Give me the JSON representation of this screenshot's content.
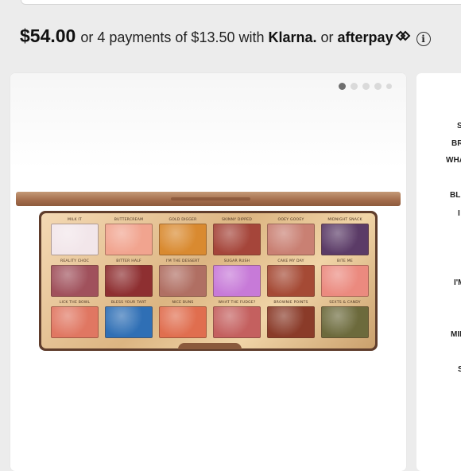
{
  "pricing": {
    "price": "$54.00",
    "installments_text": "or 4 payments of $13.50 with",
    "klarna_label": "Klarna.",
    "or_text": "or",
    "afterpay_label": "afterpay"
  },
  "icons": {
    "afterpay": "afterpay-arrows-icon",
    "info": "info-icon"
  },
  "gallery": {
    "dots": [
      true,
      false,
      false,
      false,
      false
    ]
  },
  "side_panel_fragments": [
    "S",
    "BR",
    "WHA",
    "BLE",
    "I",
    "I'M",
    "MIL",
    "S"
  ],
  "palette": {
    "shades": [
      {
        "name": "MILK IT",
        "color": "#f2e6ea"
      },
      {
        "name": "BUTTERCREAM",
        "color": "#f1a48f"
      },
      {
        "name": "GOLD DIGGER",
        "color": "#d98a30"
      },
      {
        "name": "SKINNY DIPPED",
        "color": "#a5453a"
      },
      {
        "name": "OOEY GOOEY",
        "color": "#c98073"
      },
      {
        "name": "MIDNIGHT SNACK",
        "color": "#5b3b67"
      },
      {
        "name": "REALITY CHOC",
        "color": "#a0515c"
      },
      {
        "name": "BITTER HALF",
        "color": "#8e2f31"
      },
      {
        "name": "I'M THE DESSERT",
        "color": "#b06f63"
      },
      {
        "name": "SUGAR RUSH",
        "color": "#c77ad8"
      },
      {
        "name": "CAKE MY DAY",
        "color": "#a54a35"
      },
      {
        "name": "BITE ME",
        "color": "#eb8a7f"
      },
      {
        "name": "LICK THE BOWL",
        "color": "#e07762"
      },
      {
        "name": "BLESS YOUR TART",
        "color": "#2f6fb5"
      },
      {
        "name": "NICE BUNS",
        "color": "#e06e4f"
      },
      {
        "name": "WHAT THE FUDGE?",
        "color": "#c4605f"
      },
      {
        "name": "BROWNIE POINTS",
        "color": "#8a3b29"
      },
      {
        "name": "SEXTS & CANDY",
        "color": "#6c6a3c"
      }
    ]
  },
  "colors": {
    "background": "#ececec",
    "card": "#ffffff",
    "dot_active": "#6f6f6f",
    "dot_inactive": "#dadada"
  }
}
